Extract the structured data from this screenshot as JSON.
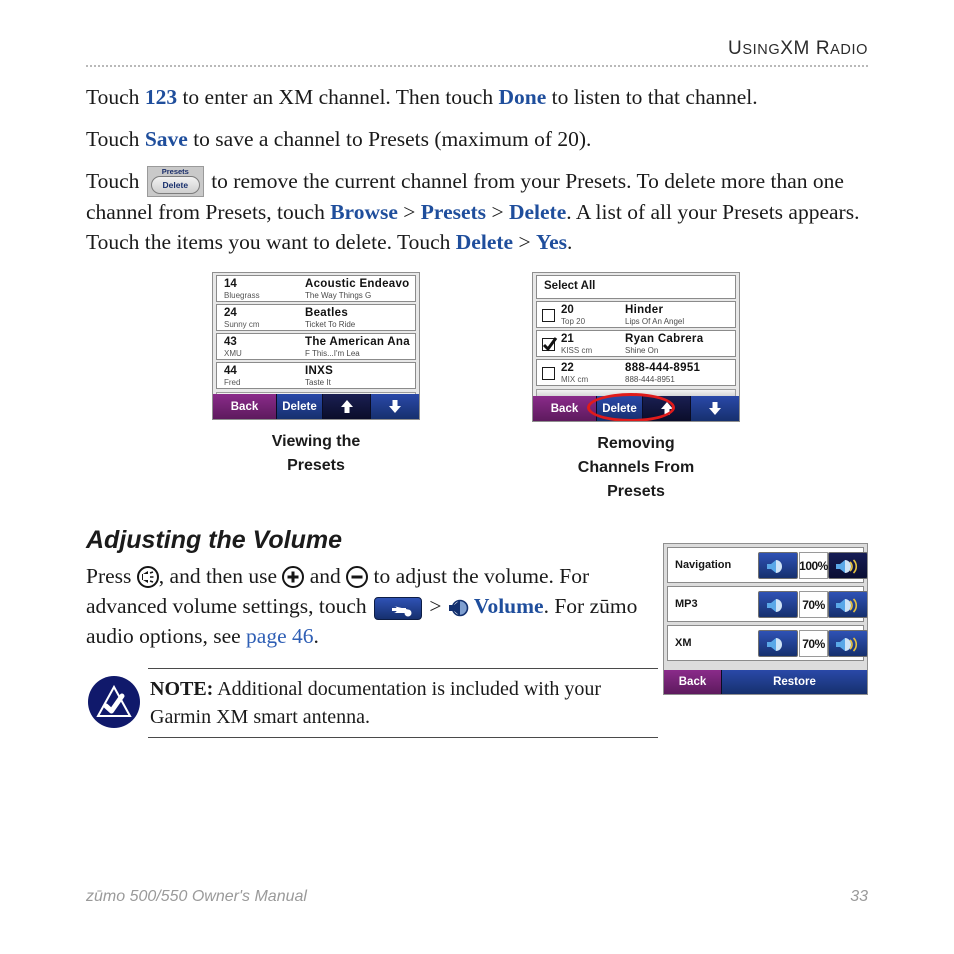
{
  "header": {
    "title_prefix": "U",
    "title": "USING XM RADIO",
    "title_parts": [
      "U",
      "SING",
      "XM R",
      "ADIO"
    ]
  },
  "paragraphs": {
    "p1_a": "Touch ",
    "p1_kw1": "123",
    "p1_b": " to enter an XM channel. Then touch ",
    "p1_kw2": "Done",
    "p1_c": " to listen to that channel.",
    "p2_a": "Touch ",
    "p2_kw1": "Save",
    "p2_b": " to save a channel to Presets (maximum of 20).",
    "p3_a": "Touch ",
    "p3_btn_top": "Presets",
    "p3_btn_bottom": "Delete",
    "p3_b": " to remove the current channel from your Presets. To delete more than one channel from Presets, touch ",
    "p3_kw1": "Browse",
    "p3_sep1": " > ",
    "p3_kw2": "Presets",
    "p3_sep2": " > ",
    "p3_kw3": "Delete",
    "p3_c": ". A list of all your Presets appears. Touch the items you want to delete. Touch ",
    "p3_kw4": "Delete",
    "p3_sep3": " > ",
    "p3_kw5": "Yes",
    "p3_d": "."
  },
  "screenshot_presets": {
    "rows": [
      {
        "num": "14",
        "sub": "Bluegrass",
        "title": "Acoustic Endeavo",
        "desc": "The Way Things G"
      },
      {
        "num": "24",
        "sub": "Sunny cm",
        "title": "Beatles",
        "desc": "Ticket To Ride"
      },
      {
        "num": "43",
        "sub": "XMU",
        "title": "The American Ana",
        "desc": "F This...I'm Lea"
      },
      {
        "num": "44",
        "sub": "Fred",
        "title": "INXS",
        "desc": "Taste It"
      }
    ],
    "buttons": {
      "back": "Back",
      "delete": "Delete",
      "up": "up-arrow-icon",
      "down": "down-arrow-icon"
    },
    "caption_line1": "Viewing the",
    "caption_line2": "Presets"
  },
  "screenshot_remove": {
    "select_all": "Select All",
    "rows": [
      {
        "num": "20",
        "sub": "Top 20",
        "title": "Hinder",
        "desc": "Lips Of An Angel",
        "checked": false
      },
      {
        "num": "21",
        "sub": "KISS cm",
        "title": "Ryan Cabrera",
        "desc": "Shine On",
        "checked": true
      },
      {
        "num": "22",
        "sub": "MIX cm",
        "title": "888-444-8951",
        "desc": "888-444-8951",
        "checked": false
      }
    ],
    "buttons": {
      "back": "Back",
      "delete": "Delete",
      "up": "up-arrow-icon",
      "down": "down-arrow-icon"
    },
    "highlight_color": "#e01b1b",
    "caption_line1": "Removing",
    "caption_line2": "Channels From",
    "caption_line3": "Presets"
  },
  "volume_section": {
    "heading": "Adjusting the Volume",
    "t1": "Press ",
    "icon_volume": "volume-circle-icon",
    "t2": ", and then use ",
    "icon_plus": "plus-circle-icon",
    "t3": " and ",
    "icon_minus": "minus-circle-icon",
    "t4": " to adjust the volume. For advanced volume settings, touch ",
    "icon_wrench": "wrench-button-icon",
    "t5": " > ",
    "icon_speaker": "speaker-icon",
    "kw_volume": "Volume",
    "t6": ". For zūmo audio options, see ",
    "link_page": "page 46",
    "t7": "."
  },
  "screenshot_volume": {
    "rows": [
      {
        "label": "Navigation",
        "value": "100%",
        "minus": "volume-down-icon",
        "plus": "volume-up-icon"
      },
      {
        "label": "MP3",
        "value": "70%",
        "minus": "volume-down-icon",
        "plus": "volume-up-icon"
      },
      {
        "label": "XM",
        "value": "70%",
        "minus": "volume-down-icon",
        "plus": "volume-up-icon"
      }
    ],
    "buttons": {
      "back": "Back",
      "restore": "Restore"
    }
  },
  "note": {
    "icon": "note-check-triangle-icon",
    "label": "NOTE:",
    "text": " Additional documentation is included with your Garmin XM smart antenna."
  },
  "footer": {
    "left": "zūmo 500/550 Owner's Manual",
    "page": "33"
  },
  "colors": {
    "keyword_blue": "#1f4e9c",
    "link_blue": "#2f5fb5",
    "highlight_red": "#e01b1b",
    "note_navy": "#10196b"
  }
}
